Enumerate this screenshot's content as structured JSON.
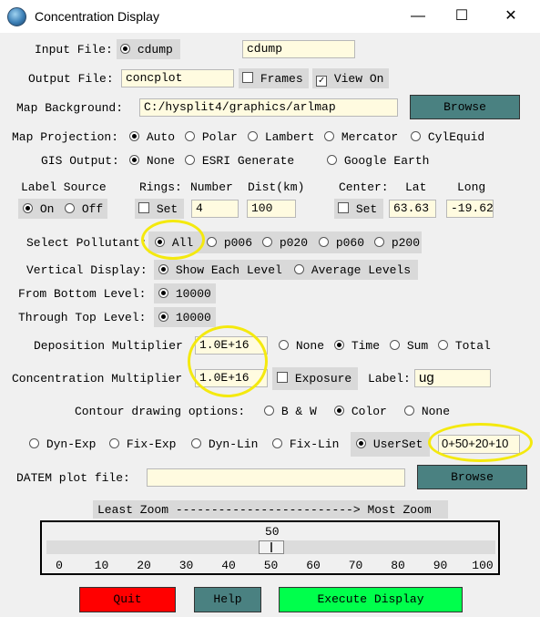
{
  "window": {
    "title": "Concentration Display",
    "minimize": "—",
    "maximize": "☐",
    "close": "✕"
  },
  "input_file": {
    "label": "Input File:",
    "radio_label": "cdump",
    "value": "cdump"
  },
  "output_file": {
    "label": "Output File:",
    "value": "concplot",
    "frames_label": "Frames",
    "frames_checked": false,
    "viewon_label": "View On",
    "viewon_checked": true
  },
  "map_background": {
    "label": "Map Background:",
    "value": "C:/hysplit4/graphics/arlmap",
    "browse_label": "Browse"
  },
  "map_projection": {
    "label": "Map Projection:",
    "options": [
      "Auto",
      "Polar",
      "Lambert",
      "Mercator",
      "CylEquid"
    ],
    "selected": "Auto"
  },
  "gis_output": {
    "label": "GIS Output:",
    "options": [
      "None",
      "ESRI Generate",
      "Google Earth"
    ],
    "selected": "None"
  },
  "label_source": {
    "header": "Label Source",
    "on": "On",
    "off": "Off",
    "selected": "On"
  },
  "rings": {
    "header_rings": "Rings:",
    "header_number": "Number",
    "header_dist": "Dist(km)",
    "set_label": "Set",
    "number": "4",
    "dist": "100"
  },
  "center": {
    "header": "Center:",
    "lat_header": "Lat",
    "long_header": "Long",
    "set_label": "Set",
    "lat": "63.63",
    "long": "-19.62"
  },
  "pollutant": {
    "label": "Select Pollutant:",
    "options": [
      "All",
      "p006",
      "p020",
      "p060",
      "p200"
    ],
    "selected": "All"
  },
  "vertical_display": {
    "label": "Vertical Display:",
    "options": [
      "Show Each Level",
      "Average Levels"
    ],
    "selected": "Show Each Level"
  },
  "from_bottom": {
    "label": "From Bottom Level:",
    "value": "10000"
  },
  "through_top": {
    "label": "Through Top Level:",
    "value": "10000"
  },
  "deposition": {
    "label": "Deposition Multiplier",
    "value": "1.0E+16",
    "options": [
      "None",
      "Time",
      "Sum",
      "Total"
    ],
    "selected": "Time"
  },
  "concentration": {
    "label": "Concentration Multiplier",
    "value": "1.0E+16",
    "exposure_label": "Exposure",
    "exposure_checked": false,
    "label_label": "Label:",
    "label_value": "ug"
  },
  "contour": {
    "label": "Contour drawing options:",
    "options": [
      "B & W",
      "Color",
      "None"
    ],
    "selected": "Color"
  },
  "contour_mode": {
    "options": [
      "Dyn-Exp",
      "Fix-Exp",
      "Dyn-Lin",
      "Fix-Lin",
      "UserSet"
    ],
    "selected": "UserSet",
    "userset_value": "0+50+20+10"
  },
  "datem": {
    "label": "DATEM plot file:",
    "value": "",
    "browse_label": "Browse"
  },
  "zoom": {
    "label": "Least Zoom -------------------------> Most Zoom",
    "value": 50,
    "value_text": "50",
    "ticks": [
      "0",
      "10",
      "20",
      "30",
      "40",
      "50",
      "60",
      "70",
      "80",
      "90",
      "100"
    ]
  },
  "buttons": {
    "quit": "Quit",
    "help": "Help",
    "execute": "Execute Display"
  },
  "colors": {
    "field_bg": "#fffbe0",
    "browse_bg": "#4a8181",
    "quit_bg": "#ff0000",
    "help_bg": "#4a8181",
    "execute_bg": "#00ff4c",
    "highlight": "#f4e90e"
  }
}
